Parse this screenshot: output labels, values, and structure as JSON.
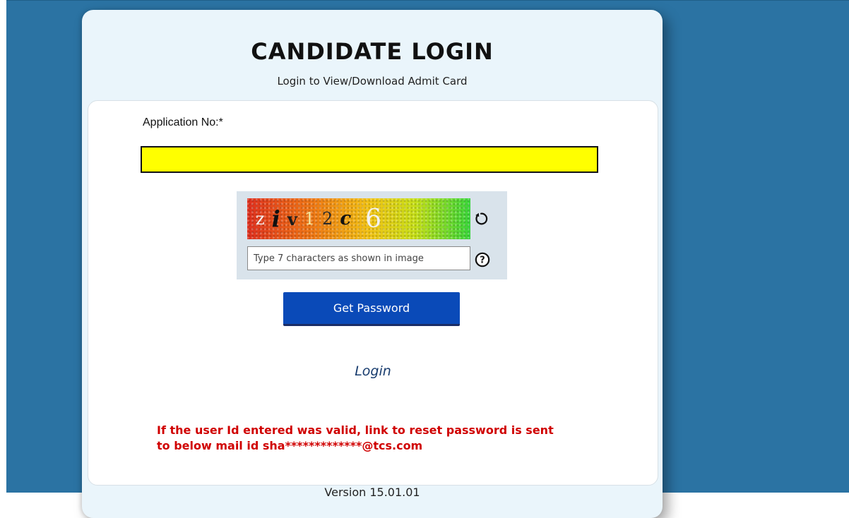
{
  "page": {
    "title": "CANDIDATE LOGIN",
    "subtitle": "Login to View/Download Admit Card"
  },
  "form": {
    "application_label": "Application No:*",
    "application_value": "",
    "captcha": {
      "chars": [
        "z",
        "i",
        "v",
        "1",
        "2",
        "c",
        "6"
      ],
      "input_value": "",
      "input_placeholder": "Type 7 characters as shown in image",
      "refresh_icon": "refresh-icon",
      "help_icon": "help-icon"
    },
    "get_password_label": "Get Password",
    "login_link": "Login"
  },
  "message": {
    "line1": "If the user Id entered was valid, link to reset password is sent",
    "line2": "to below mail id sha*************@tcs.com",
    "color": "#d00000"
  },
  "footer": {
    "version": "Version 15.01.01"
  },
  "colors": {
    "background": "#2b73a3",
    "card": "#eaf5fb",
    "highlight_input": "#ffff00",
    "button": "#0a4ab8"
  }
}
